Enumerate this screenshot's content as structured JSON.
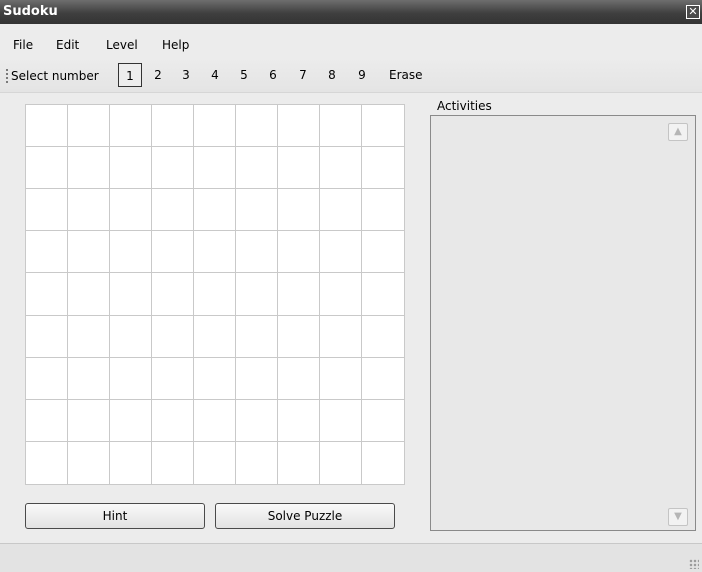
{
  "window": {
    "title": "Sudoku",
    "close_glyph": "✕"
  },
  "menu": {
    "items": [
      "File",
      "Edit",
      "Level",
      "Help"
    ]
  },
  "toolbar": {
    "label": "Select number",
    "numbers": [
      "1",
      "2",
      "3",
      "4",
      "5",
      "6",
      "7",
      "8",
      "9"
    ],
    "selected_number": "1",
    "erase_label": "Erase"
  },
  "grid": {
    "rows": [
      [
        "",
        "",
        "",
        "",
        "",
        "",
        "",
        "",
        ""
      ],
      [
        "",
        "",
        "",
        "",
        "",
        "",
        "",
        "",
        ""
      ],
      [
        "",
        "",
        "",
        "",
        "",
        "",
        "",
        "",
        ""
      ],
      [
        "",
        "",
        "",
        "",
        "",
        "",
        "",
        "",
        ""
      ],
      [
        "",
        "",
        "",
        "",
        "",
        "",
        "",
        "",
        ""
      ],
      [
        "",
        "",
        "",
        "",
        "",
        "",
        "",
        "",
        ""
      ],
      [
        "",
        "",
        "",
        "",
        "",
        "",
        "",
        "",
        ""
      ],
      [
        "",
        "",
        "",
        "",
        "",
        "",
        "",
        "",
        ""
      ],
      [
        "",
        "",
        "",
        "",
        "",
        "",
        "",
        "",
        ""
      ]
    ]
  },
  "buttons": {
    "hint": "Hint",
    "solve": "Solve Puzzle"
  },
  "activities": {
    "label": "Activities",
    "scroll_up_glyph": "▲",
    "scroll_down_glyph": "▼"
  },
  "status": {
    "text": ""
  }
}
